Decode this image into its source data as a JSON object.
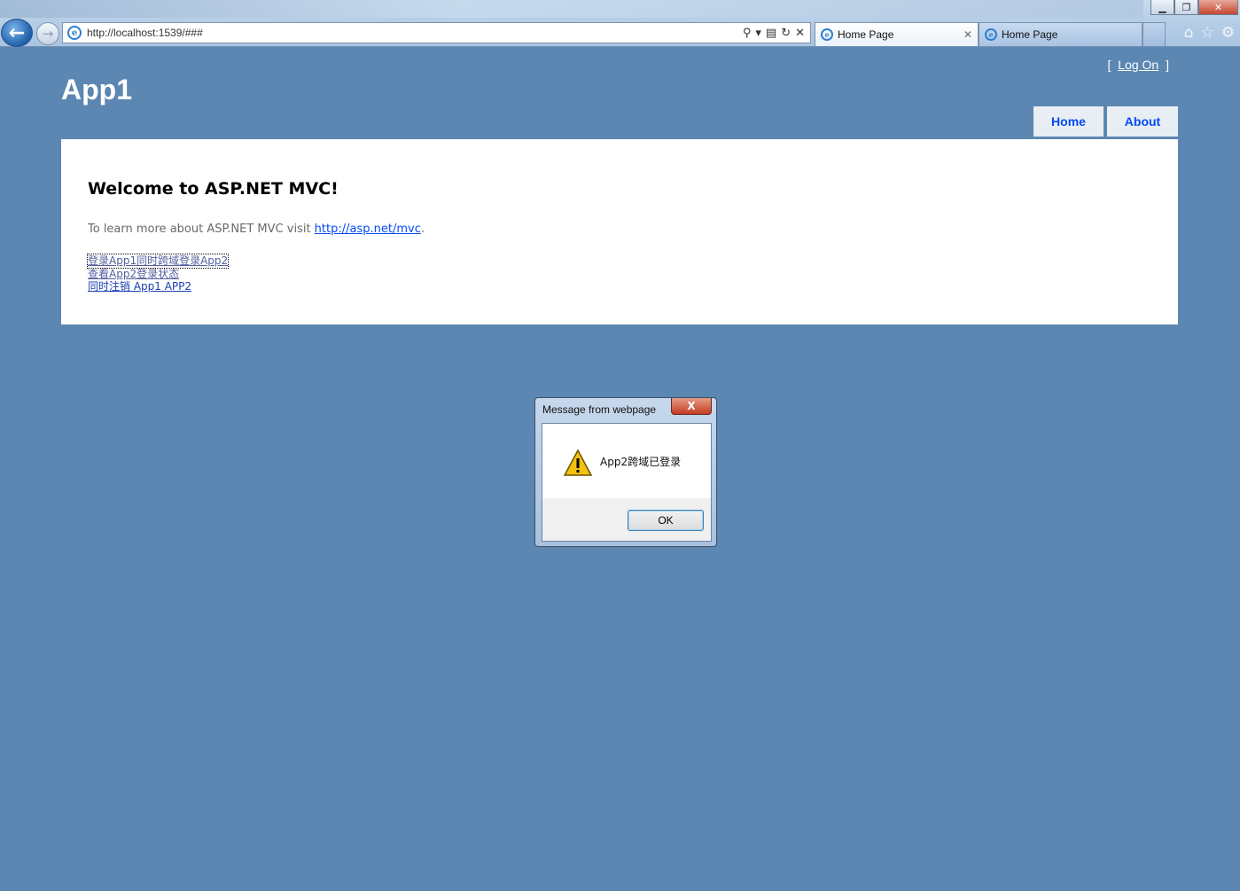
{
  "browser": {
    "address": "http://localhost:1539/###",
    "tabs": [
      {
        "title": "Home Page",
        "active": true
      },
      {
        "title": "Home Page",
        "active": false
      }
    ],
    "back_glyph": "←",
    "forward_glyph": "→",
    "window_buttons": {
      "minimize": "▁",
      "restore": "❐",
      "close": "✕"
    },
    "toolbar_icons": [
      "home-icon",
      "favorites-star-icon",
      "tools-gear-icon"
    ]
  },
  "page": {
    "app_title": "App1",
    "logon": {
      "open_bracket": "[",
      "label": "Log On",
      "close_bracket": "]"
    },
    "menu": {
      "home": "Home",
      "about": "About"
    },
    "heading": "Welcome to ASP.NET MVC!",
    "learn_text": "To learn more about ASP.NET MVC visit ",
    "learn_link": "http://asp.net/mvc",
    "learn_end": ".",
    "links": [
      "登录App1同时跨域登录App2",
      "查看App2登录状态",
      "同时注销   App1  APP2"
    ]
  },
  "dialog": {
    "title": "Message from webpage",
    "close": "X",
    "message": "App2跨域已登录",
    "ok": "OK"
  },
  "colors": {
    "page_bg": "#5c87b2",
    "menu_bg": "#e8eef4",
    "link": "#034af3"
  }
}
